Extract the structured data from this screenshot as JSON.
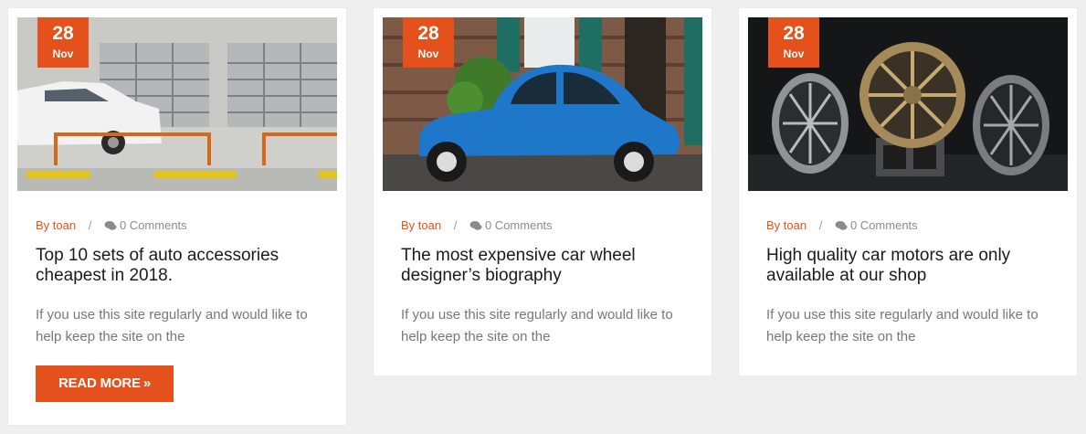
{
  "posts": [
    {
      "date_day": "28",
      "date_month": "Nov",
      "author": "By toan",
      "separator": "/",
      "comments": "0 Comments",
      "title": "Top 10 sets of auto accessories cheapest in 2018.",
      "excerpt": "If you use this site regularly and would like to help keep the site on the",
      "image": "photo of white car parked near garage doors and orange barriers"
    },
    {
      "date_day": "28",
      "date_month": "Nov",
      "author": "By toan",
      "separator": "/",
      "comments": "0 Comments",
      "title": "The most expensive car wheel designer’s biography",
      "excerpt": "If you use this site regularly and would like to help keep the site on the",
      "image": "photo of blue vintage car in front of brick building"
    },
    {
      "date_day": "28",
      "date_month": "Nov",
      "author": "By toan",
      "separator": "/",
      "comments": "0 Comments",
      "title": "High quality car motors are only available at our shop",
      "excerpt": "If you use this site regularly and would like to help keep the site on the",
      "image": "photo of three alloy car wheels on dark background"
    }
  ],
  "read_more": {
    "label": "READ MORE",
    "icon": "double-chevron-right-icon"
  },
  "colors": {
    "accent": "#e4511c",
    "page_bg": "#efefef",
    "card_bg": "#ffffff",
    "title": "#1b1b1b",
    "muted": "#8a8a8a"
  }
}
